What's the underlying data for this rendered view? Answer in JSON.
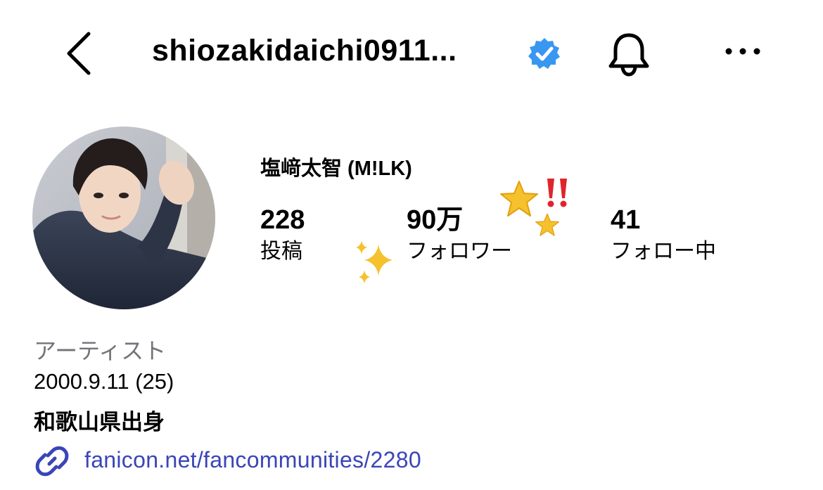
{
  "header": {
    "username": "shiozakidaichi0911...",
    "back_icon": "chevron-left-icon",
    "verified_icon": "verified-badge-icon",
    "bell_icon": "bell-icon",
    "more_icon": "more-horizontal-icon"
  },
  "profile": {
    "display_name": "塩﨑太智 (M!LK)",
    "stats": [
      {
        "count": "228",
        "label": "投稿"
      },
      {
        "count": "90万",
        "label": "フォロワー"
      },
      {
        "count": "41",
        "label": "フォロー中"
      }
    ]
  },
  "bio": {
    "category": "アーティスト",
    "lines": [
      "2000.9.11 (25)",
      "和歌山県出身"
    ]
  },
  "link": {
    "icon": "link-icon",
    "url_text": "fanicon.net/fancommunities/2280"
  },
  "colors": {
    "verified_blue": "#3897f0",
    "link_blue": "#3a45b8",
    "category_gray": "#73737a",
    "star_yellow": "#f5c12d",
    "exclaim_red": "#e0242b"
  }
}
